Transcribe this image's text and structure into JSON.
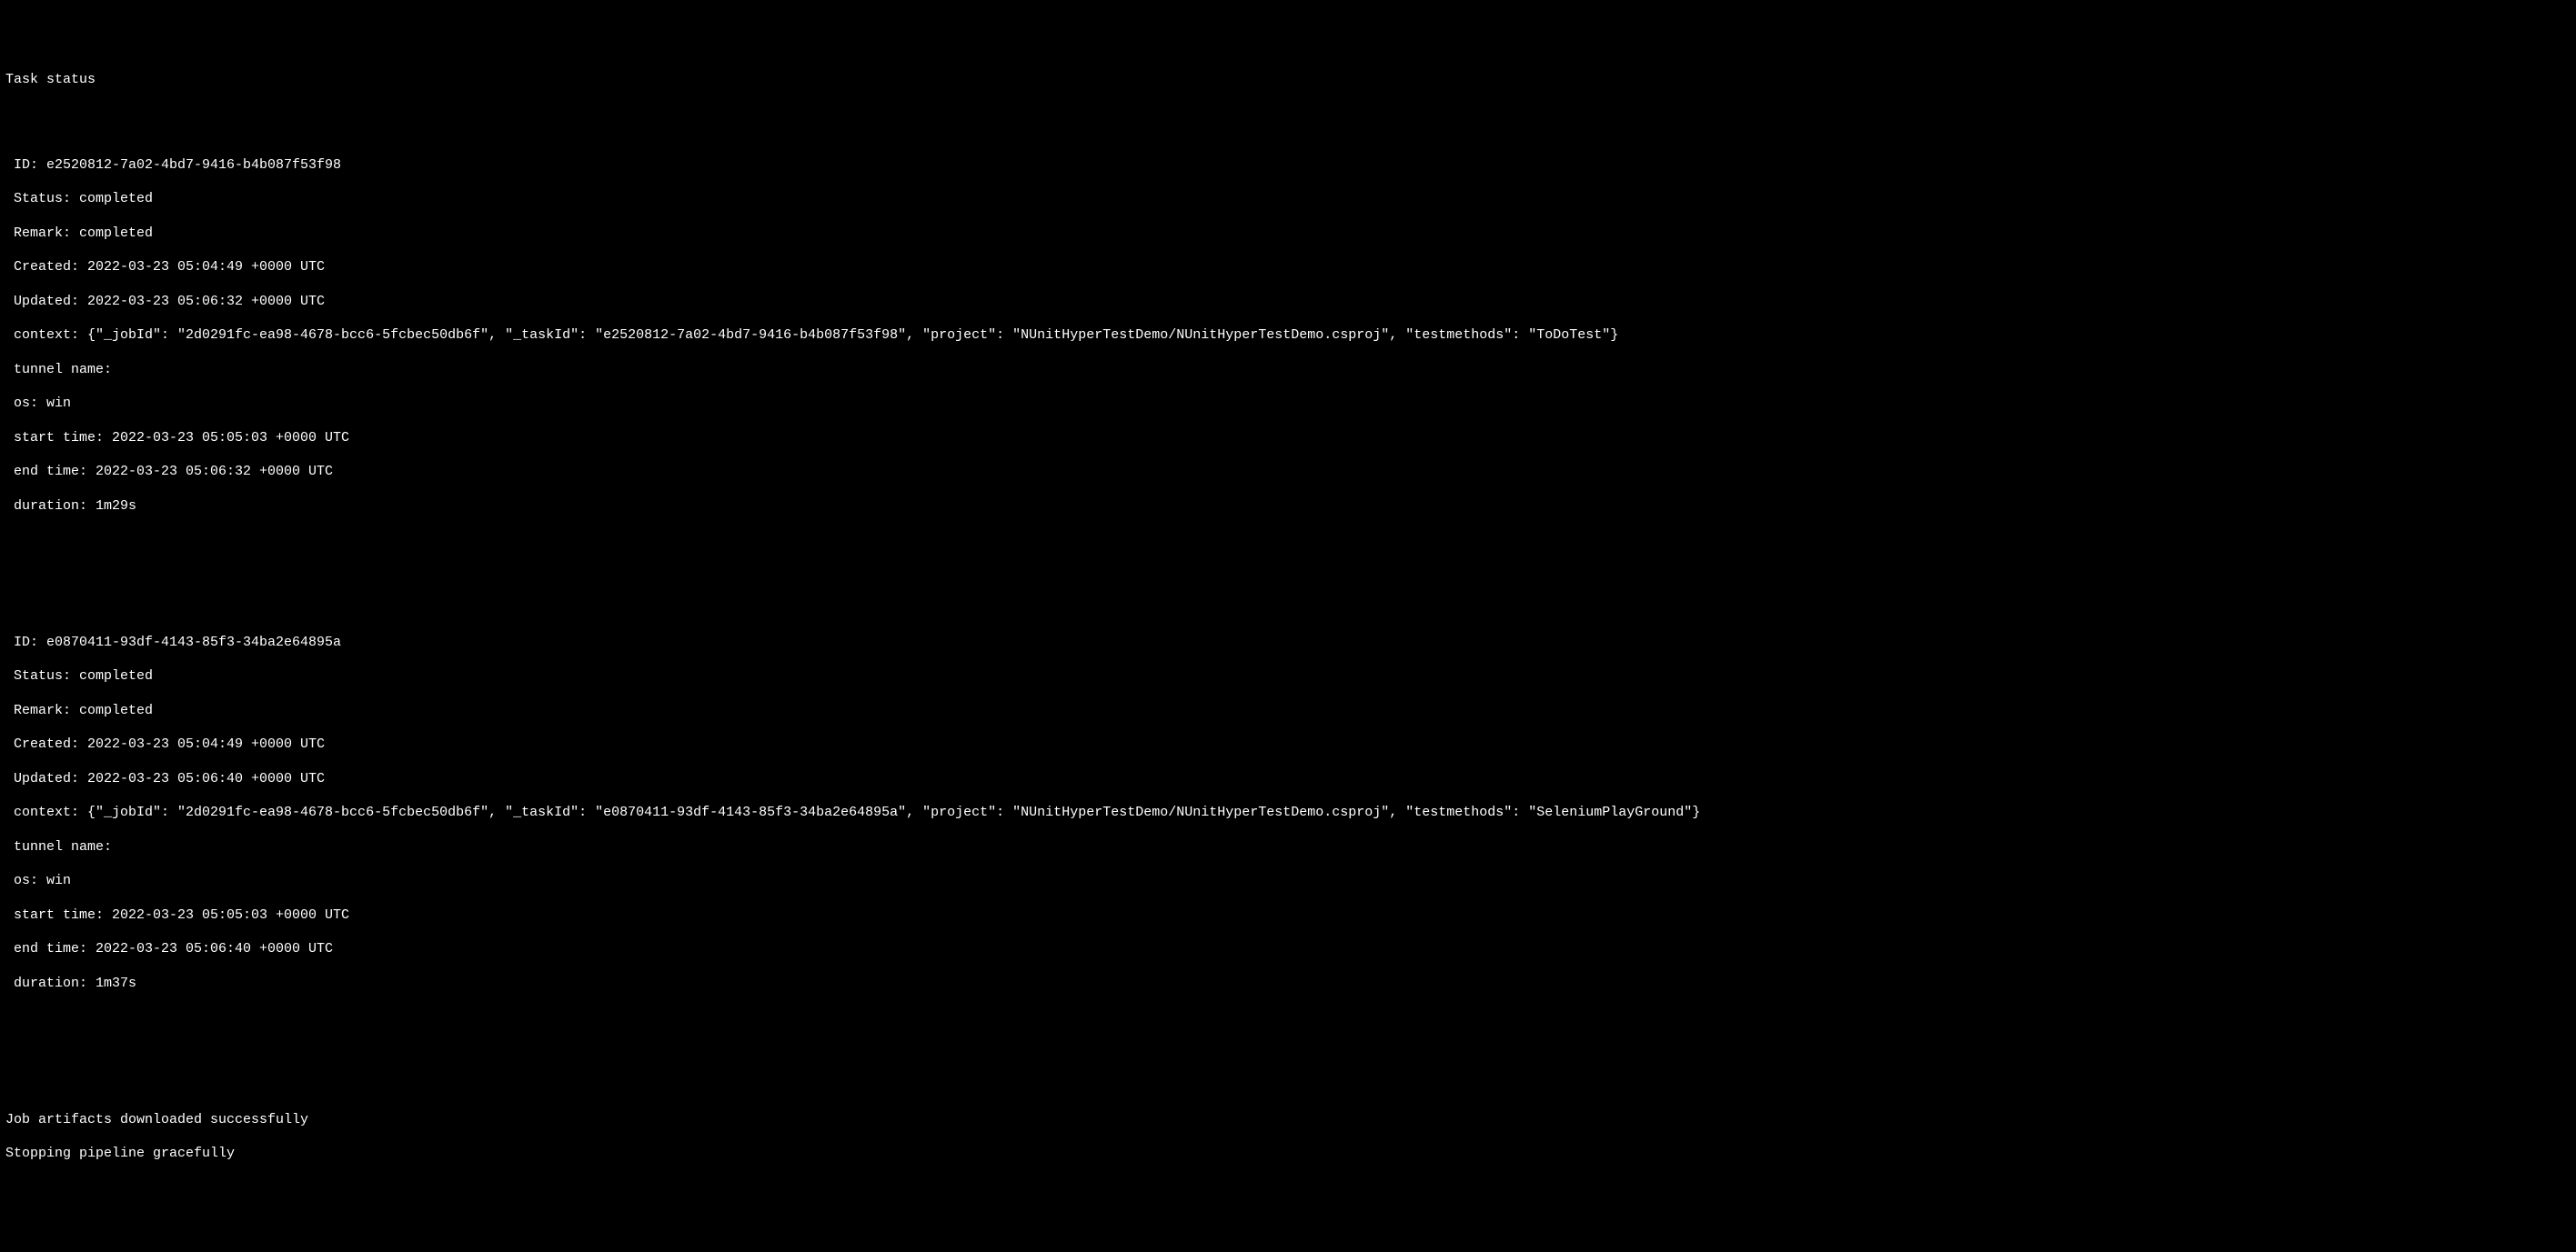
{
  "header": "Task status",
  "tasks": [
    {
      "lines": {
        "id": "ID: e2520812-7a02-4bd7-9416-b4b087f53f98",
        "status": "Status: completed",
        "remark": "Remark: completed",
        "created": "Created: 2022-03-23 05:04:49 +0000 UTC",
        "updated": "Updated: 2022-03-23 05:06:32 +0000 UTC",
        "context": "context: {\"_jobId\": \"2d0291fc-ea98-4678-bcc6-5fcbec50db6f\", \"_taskId\": \"e2520812-7a02-4bd7-9416-b4b087f53f98\", \"project\": \"NUnitHyperTestDemo/NUnitHyperTestDemo.csproj\", \"testmethods\": \"ToDoTest\"}",
        "tunnel": "tunnel name:",
        "os": "os: win",
        "start": "start time: 2022-03-23 05:05:03 +0000 UTC",
        "end": "end time: 2022-03-23 05:06:32 +0000 UTC",
        "duration": "duration: 1m29s"
      }
    },
    {
      "lines": {
        "id": "ID: e0870411-93df-4143-85f3-34ba2e64895a",
        "status": "Status: completed",
        "remark": "Remark: completed",
        "created": "Created: 2022-03-23 05:04:49 +0000 UTC",
        "updated": "Updated: 2022-03-23 05:06:40 +0000 UTC",
        "context": "context: {\"_jobId\": \"2d0291fc-ea98-4678-bcc6-5fcbec50db6f\", \"_taskId\": \"e0870411-93df-4143-85f3-34ba2e64895a\", \"project\": \"NUnitHyperTestDemo/NUnitHyperTestDemo.csproj\", \"testmethods\": \"SeleniumPlayGround\"}",
        "tunnel": "tunnel name:",
        "os": "os: win",
        "start": "start time: 2022-03-23 05:05:03 +0000 UTC",
        "end": "end time: 2022-03-23 05:06:40 +0000 UTC",
        "duration": "duration: 1m37s"
      }
    }
  ],
  "footer": {
    "artifacts": "Job artifacts downloaded successfully",
    "stopping": "Stopping pipeline gracefully"
  }
}
